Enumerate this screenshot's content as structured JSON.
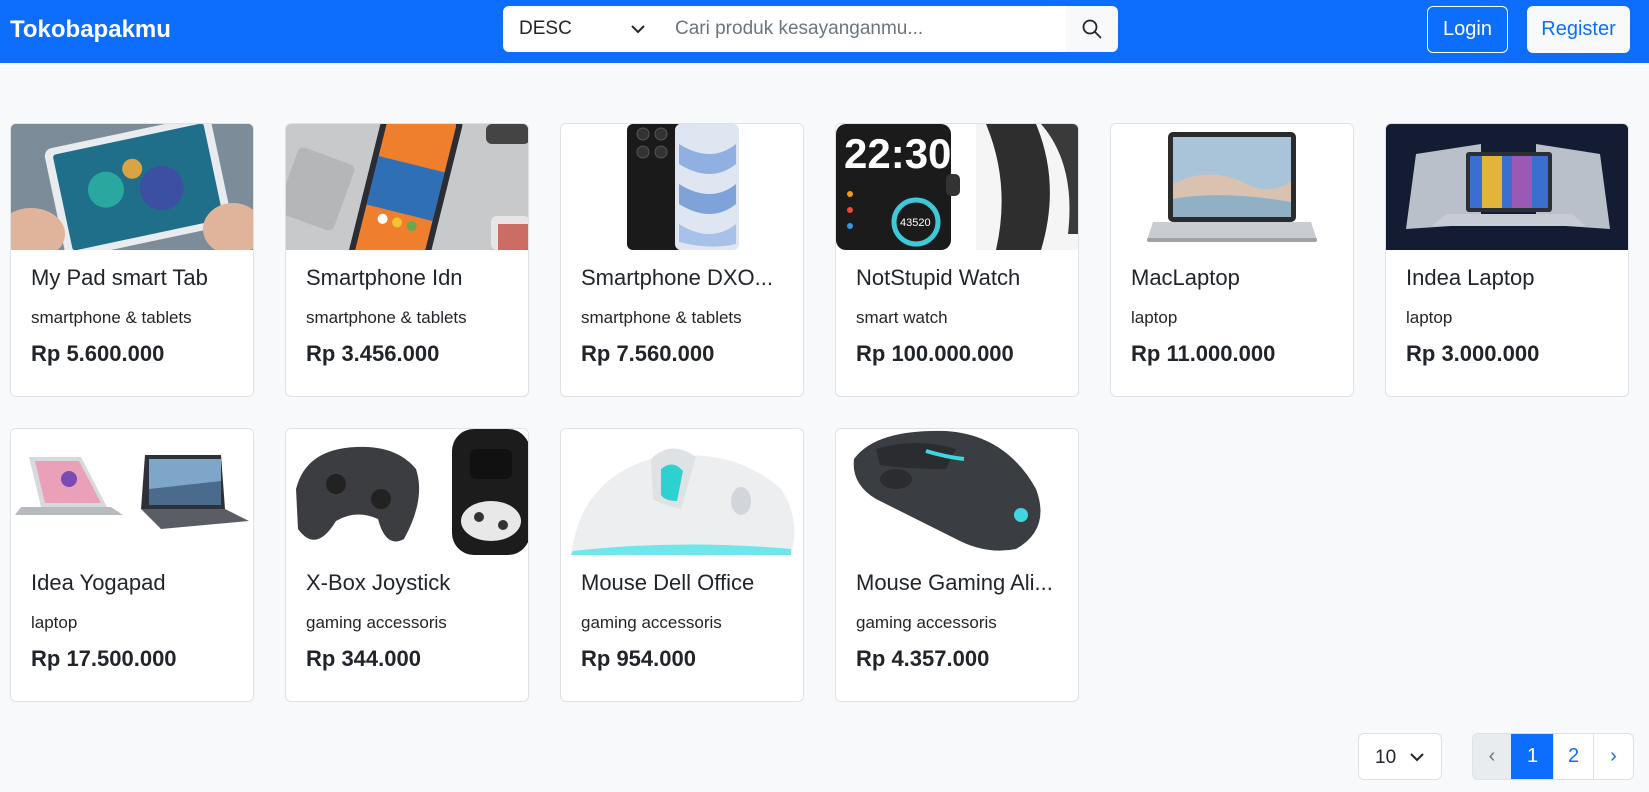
{
  "navbar": {
    "brand": "Tokobapakmu",
    "sort_value": "DESC",
    "search_placeholder": "Cari produk kesayanganmu...",
    "login_label": "Login",
    "register_label": "Register"
  },
  "products": [
    {
      "name": "My Pad smart Tab",
      "category": "smartphone & tablets",
      "price": "Rp 5.600.000"
    },
    {
      "name": "Smartphone Idn",
      "category": "smartphone & tablets",
      "price": "Rp 3.456.000"
    },
    {
      "name": "Smartphone DXO...",
      "category": "smartphone & tablets",
      "price": "Rp 7.560.000"
    },
    {
      "name": "NotStupid Watch",
      "category": "smart watch",
      "price": "Rp 100.000.000"
    },
    {
      "name": "MacLaptop",
      "category": "laptop",
      "price": "Rp 11.000.000"
    },
    {
      "name": "Indea Laptop",
      "category": "laptop",
      "price": "Rp 3.000.000"
    },
    {
      "name": "Idea Yogapad",
      "category": "laptop",
      "price": "Rp 17.500.000"
    },
    {
      "name": "X-Box Joystick",
      "category": "gaming accessoris",
      "price": "Rp 344.000"
    },
    {
      "name": "Mouse Dell Office",
      "category": "gaming accessoris",
      "price": "Rp 954.000"
    },
    {
      "name": "Mouse Gaming Ali...",
      "category": "gaming accessoris",
      "price": "Rp 4.357.000"
    }
  ],
  "watch_readout": {
    "time": "22:30",
    "steps": "43520"
  },
  "pagination": {
    "per_page": "10",
    "prev": "‹",
    "pages": [
      "1",
      "2"
    ],
    "next": "›",
    "active_page": "1"
  },
  "colors": {
    "primary": "#0d6efd",
    "background": "#f8f9fa"
  }
}
